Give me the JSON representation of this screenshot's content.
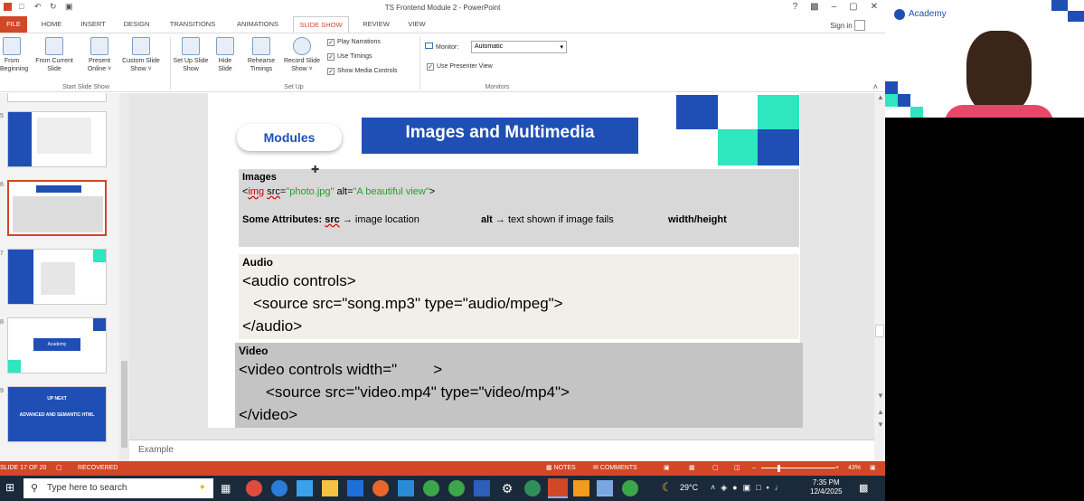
{
  "window": {
    "title": "TS Frontend Module 2 - PowerPoint",
    "signin": "Sign in",
    "help": "?",
    "minimize": "–",
    "restore": "▢",
    "close": "✕"
  },
  "tabs": [
    "FILE",
    "HOME",
    "INSERT",
    "DESIGN",
    "TRANSITIONS",
    "ANIMATIONS",
    "SLIDE SHOW",
    "REVIEW",
    "VIEW"
  ],
  "ribbon": {
    "from_beginning": "From Beginning",
    "from_current": "From Current Slide",
    "present_online": "Present Online ˅",
    "custom_show": "Custom Slide Show ˅",
    "group_start": "Start Slide Show",
    "setup_show": "Set Up Slide Show",
    "hide_slide": "Hide Slide",
    "rehearse": "Rehearse Timings",
    "record": "Record Slide Show ˅",
    "play_narrations": "Play Narrations",
    "use_timings": "Use Timings",
    "show_media": "Show Media Controls",
    "group_setup": "Set Up",
    "monitor_label": "Monitor:",
    "monitor_value": "Automatic",
    "presenter_view": "Use Presenter View",
    "group_monitors": "Monitors"
  },
  "thumbs": {
    "n1": "5",
    "n2": "6",
    "n3": "7",
    "n4": "8",
    "n5": "9",
    "t5_line1": "UP NEXT",
    "t5_line2": "ADVANCED AND SEMANTIC HTML",
    "t4_logo": "Academy"
  },
  "slide": {
    "badge": "Modules",
    "title": "Images and Multimedia",
    "images_heading": "Images",
    "img_code_1": "<",
    "img_code_tag": "img",
    "img_code_2": " ",
    "img_code_src": "src",
    "img_code_3": "=",
    "img_code_val1": "\"photo.jpg\"",
    "img_code_4": " alt=",
    "img_code_val2": "\"A beautiful view\"",
    "img_code_5": ">",
    "attrs_label": "Some Attributes: ",
    "attrs_src": "src",
    "attrs_src_desc": " → image location",
    "attrs_alt": "alt",
    "attrs_alt_desc": " → text shown if image fails",
    "attrs_wh": "width/height",
    "audio_heading": "Audio",
    "audio_l1": "<audio controls>",
    "audio_l2": "<source src=\"song.mp3\" type=\"audio/mpeg\">",
    "audio_l3": "</audio>",
    "video_heading": "Video",
    "video_l1a": "<video controls width=\"",
    "video_l1b": "",
    "video_l1c": ">",
    "video_l2": "<source src=\"video.mp4\" type=\"video/mp4\">",
    "video_l3": "</video>"
  },
  "notes": "Example",
  "status": {
    "slide": "SLIDE 17 OF 20",
    "recovered": "RECOVERED",
    "notes": "NOTES",
    "comments": "COMMENTS",
    "zoom": "43%"
  },
  "taskbar": {
    "search": "Type here to search",
    "weather": "29°C",
    "time": "7:35 PM",
    "date": "12/4/2025"
  },
  "cam": {
    "logo": "Academy"
  },
  "colors": {
    "accent": "#d24726",
    "title_blue": "#1f4fb5",
    "teal": "#2ee6c0",
    "taskbar": "#1b2a3a"
  }
}
